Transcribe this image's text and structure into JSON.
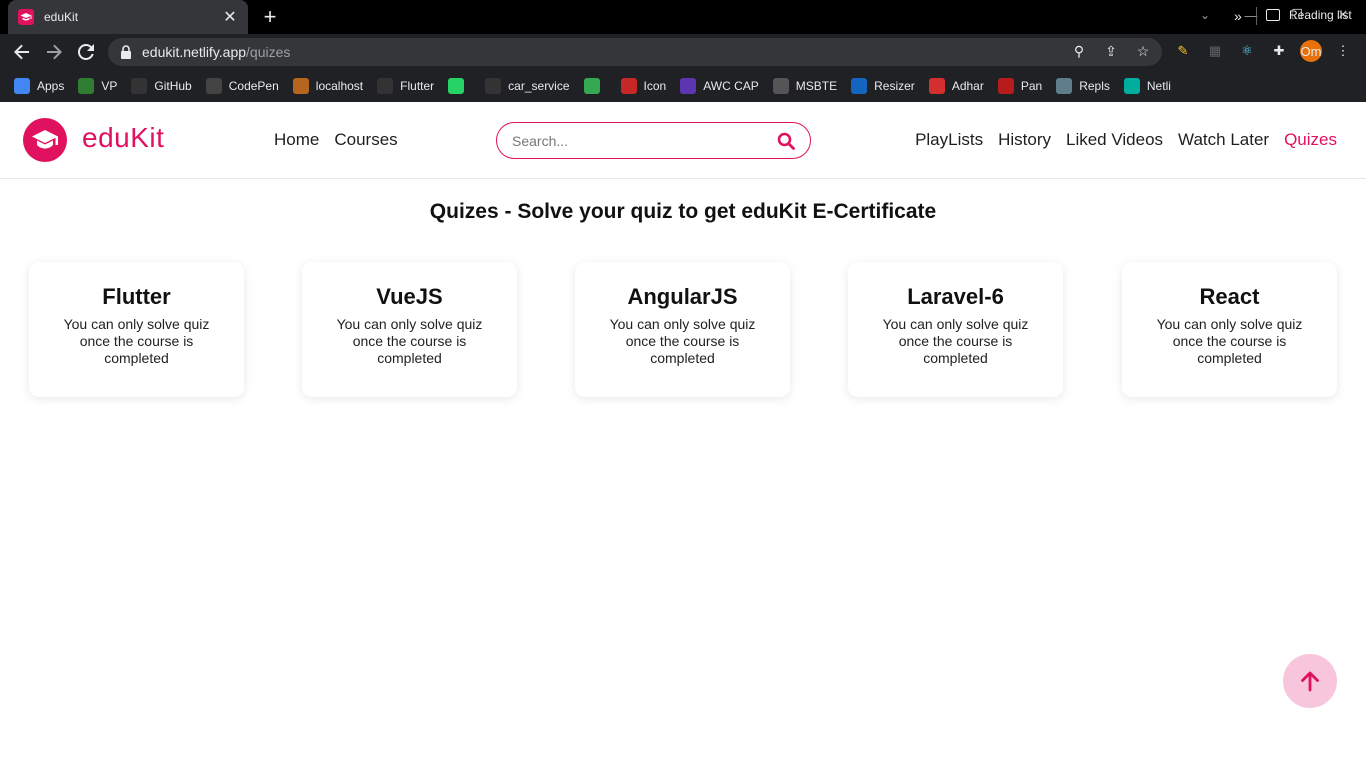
{
  "browser": {
    "tab_title": "eduKit",
    "url_host": "edukit.netlify.app",
    "url_path": "/quizes",
    "profile_initials": "Om",
    "bookmarks": [
      {
        "label": "Apps",
        "color": "#4285f4"
      },
      {
        "label": "VP",
        "color": "#2e7d32"
      },
      {
        "label": "GitHub",
        "color": "#333333"
      },
      {
        "label": "CodePen",
        "color": "#444444"
      },
      {
        "label": "localhost",
        "color": "#b5651d"
      },
      {
        "label": "Flutter",
        "color": "#333333"
      },
      {
        "label": "",
        "color": "#25d366"
      },
      {
        "label": "car_service",
        "color": "#333333"
      },
      {
        "label": "",
        "color": "#34a853"
      },
      {
        "label": "Icon",
        "color": "#c62828"
      },
      {
        "label": "AWC CAP",
        "color": "#5e35b1"
      },
      {
        "label": "MSBTE",
        "color": "#555555"
      },
      {
        "label": "Resizer",
        "color": "#1565c0"
      },
      {
        "label": "Adhar",
        "color": "#d32f2f"
      },
      {
        "label": "Pan",
        "color": "#b71c1c"
      },
      {
        "label": "Repls",
        "color": "#607d8b"
      },
      {
        "label": "Netli",
        "color": "#00ad9f"
      }
    ],
    "more_bookmarks": "»",
    "reading_list": "Reading list"
  },
  "site": {
    "brand": "eduKit",
    "accent": "#e0115f",
    "nav_left": [
      "Home",
      "Courses"
    ],
    "search_placeholder": "Search...",
    "nav_right": [
      "PlayLists",
      "History",
      "Liked Videos",
      "Watch Later",
      "Quizes"
    ],
    "active_nav": "Quizes"
  },
  "main": {
    "title": "Quizes - Solve your quiz to get eduKit E-Certificate",
    "quizzes": [
      {
        "name": "Flutter",
        "message": "You can only solve quiz once the course is completed"
      },
      {
        "name": "VueJS",
        "message": "You can only solve quiz once the course is completed"
      },
      {
        "name": "AngularJS",
        "message": "You can only solve quiz once the course is completed"
      },
      {
        "name": "Laravel-6",
        "message": "You can only solve quiz once the course is completed"
      },
      {
        "name": "React",
        "message": "You can only solve quiz once the course is completed"
      }
    ]
  }
}
